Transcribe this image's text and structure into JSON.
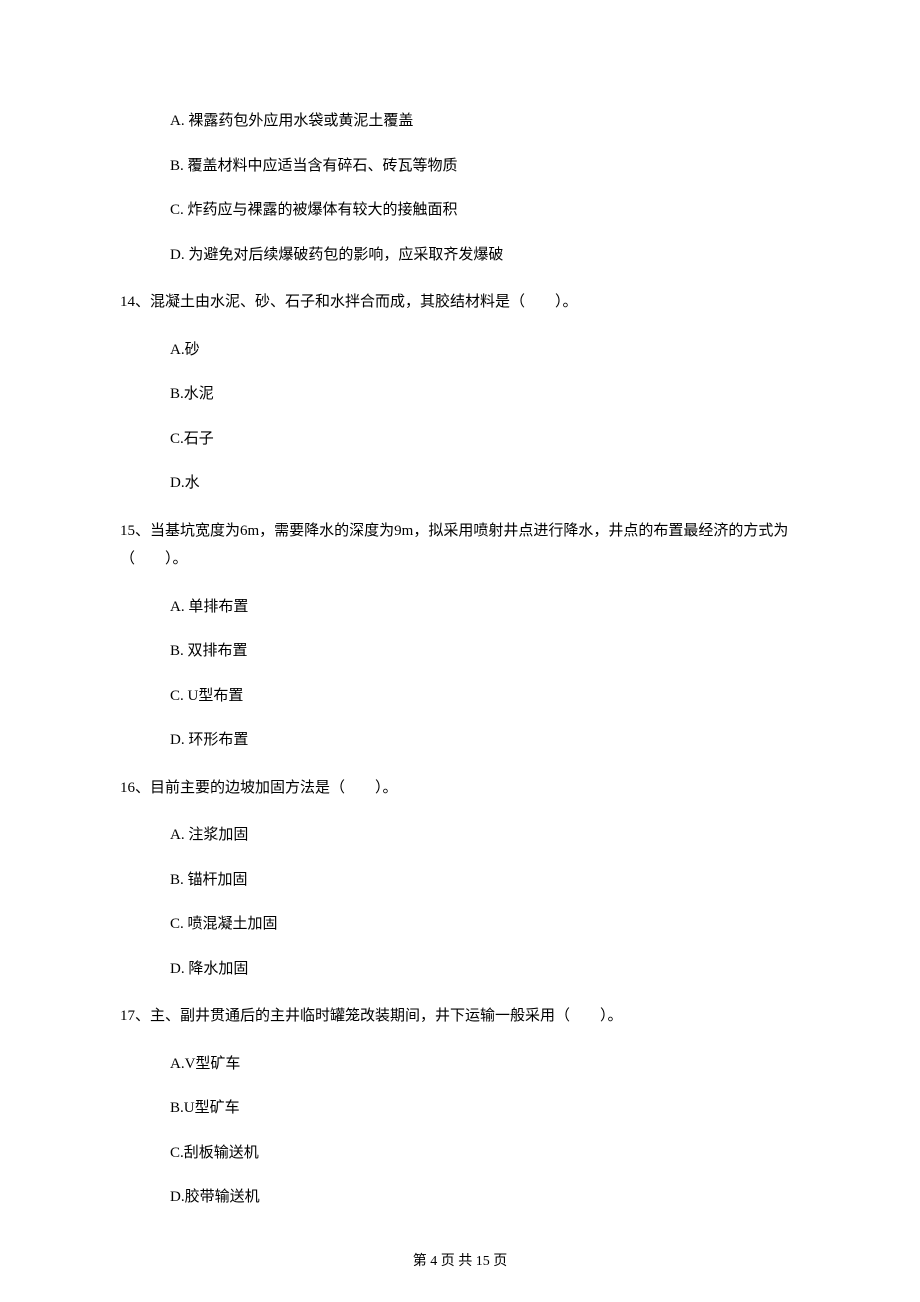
{
  "q13_options": {
    "A": "A. 裸露药包外应用水袋或黄泥土覆盖",
    "B": "B. 覆盖材料中应适当含有碎石、砖瓦等物质",
    "C": "C. 炸药应与裸露的被爆体有较大的接触面积",
    "D": "D. 为避免对后续爆破药包的影响，应采取齐发爆破"
  },
  "q14": {
    "stem": "14、混凝土由水泥、砂、石子和水拌合而成，其胶结材料是（　　）。",
    "A": "A.砂",
    "B": "B.水泥",
    "C": "C.石子",
    "D": "D.水"
  },
  "q15": {
    "stem": "15、当基坑宽度为6m，需要降水的深度为9m，拟采用喷射井点进行降水，井点的布置最经济的方式为（　　）。",
    "A": "A. 单排布置",
    "B": "B. 双排布置",
    "C": "C. U型布置",
    "D": "D. 环形布置"
  },
  "q16": {
    "stem": "16、目前主要的边坡加固方法是（　　）。",
    "A": "A. 注浆加固",
    "B": "B. 锚杆加固",
    "C": "C. 喷混凝土加固",
    "D": "D. 降水加固"
  },
  "q17": {
    "stem": "17、主、副井贯通后的主井临时罐笼改装期间，井下运输一般采用（　　）。",
    "A": "A.V型矿车",
    "B": "B.U型矿车",
    "C": "C.刮板输送机",
    "D": "D.胶带输送机"
  },
  "footer": "第 4 页 共 15 页"
}
